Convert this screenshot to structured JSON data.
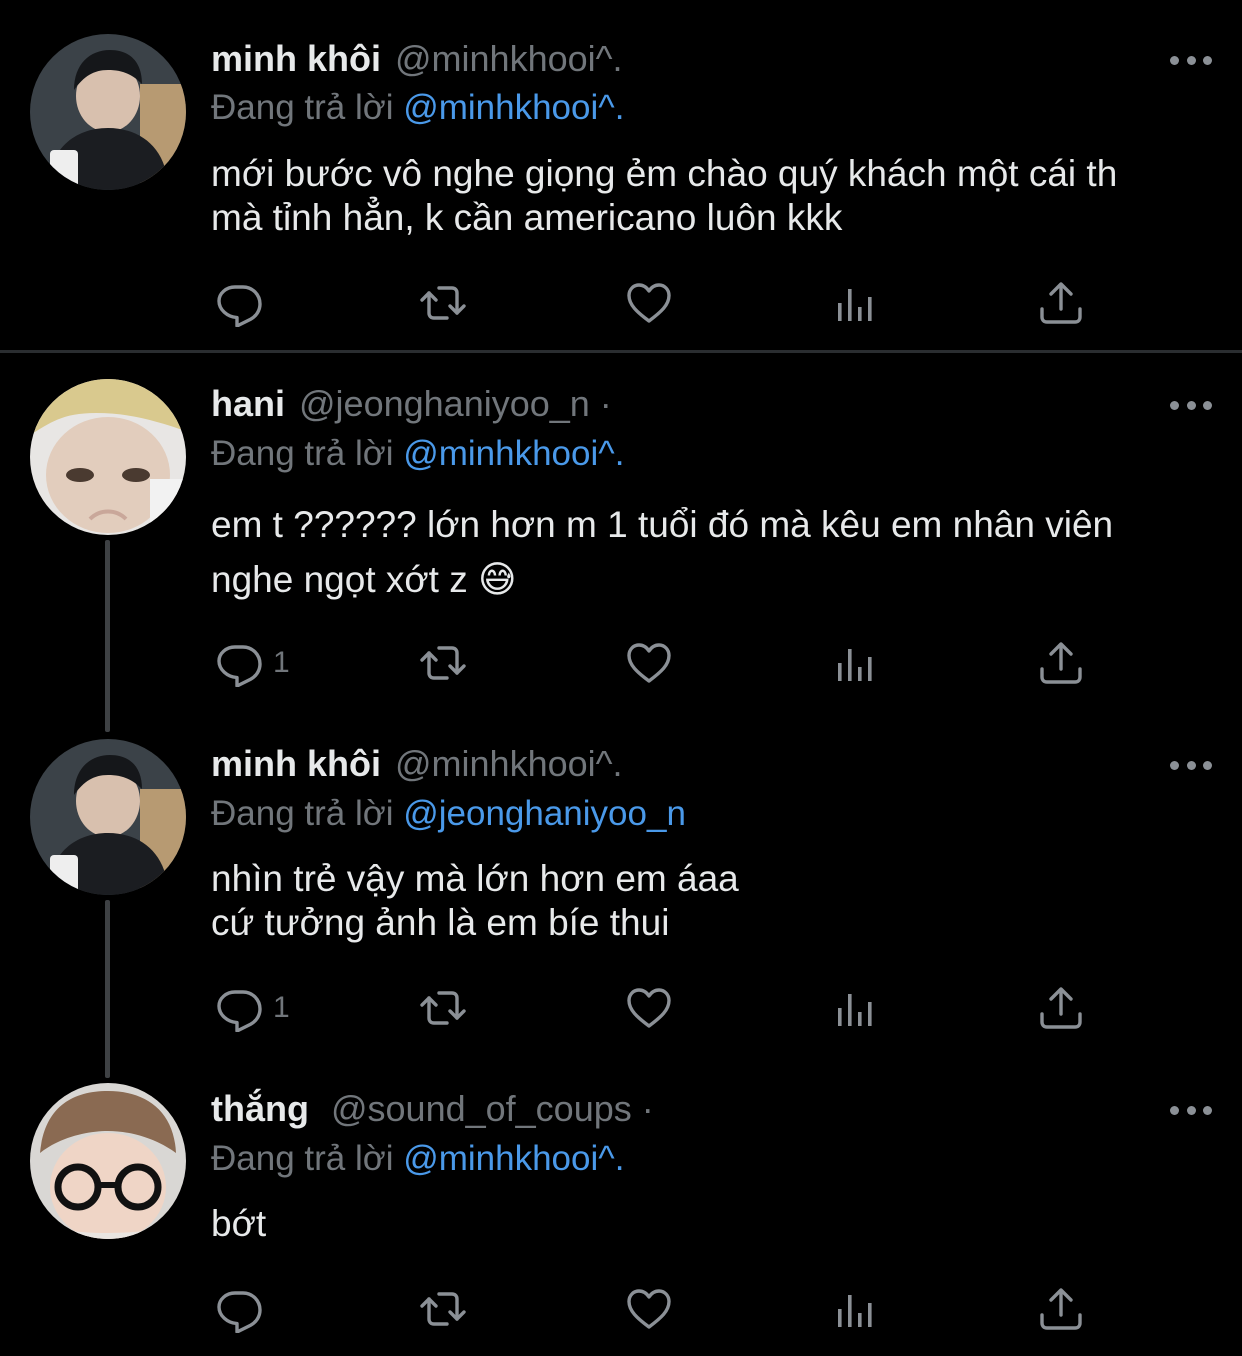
{
  "reply_prefix": "Đang trả lời",
  "tweets": [
    {
      "name": "minh khôi",
      "handle": "@minhkhooi^.",
      "reply_to": "@minhkhooi^.",
      "text_lines": [
        "mới bước vô nghe giọng ẻm chào quý khách một cái th",
        "mà tỉnh hẳn, k cần americano luôn kkk"
      ],
      "reply_count": ""
    },
    {
      "name": "hani",
      "handle": "@jeonghaniyoo_n ·",
      "reply_to": "@minhkhooi^.",
      "text_lines": [
        "em t ?????? lớn hơn m 1 tuổi đó mà kêu em nhân viên",
        "nghe ngọt xớt z 😅"
      ],
      "reply_count": "1"
    },
    {
      "name": "minh khôi",
      "handle": "@minhkhooi^.",
      "reply_to": "@jeonghaniyoo_n",
      "text_lines": [
        "nhìn trẻ vậy mà lớn hơn em áaa",
        "cứ tưởng ảnh là em bíe thui"
      ],
      "reply_count": "1"
    },
    {
      "name": "thắng",
      "handle": "@sound_of_coups ·",
      "reply_to": "@minhkhooi^.",
      "text_lines": [
        "bớt"
      ],
      "reply_count": ""
    }
  ],
  "icons": {
    "reply": "reply-icon",
    "retweet": "retweet-icon",
    "like": "heart-icon",
    "views": "views-icon",
    "share": "share-icon",
    "more": "more-icon"
  },
  "colors": {
    "background": "#000000",
    "text": "#e7e9ea",
    "muted": "#71767b",
    "mention": "#4a99e9",
    "icon": "#8b9096"
  }
}
